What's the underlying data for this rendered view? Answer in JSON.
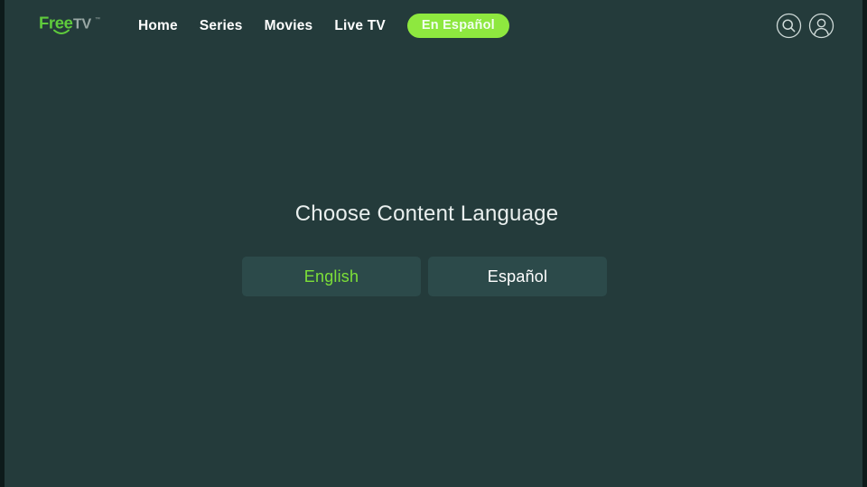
{
  "brand": {
    "name_primary": "Free",
    "name_secondary": "TV",
    "trademark": "™",
    "primary_color": "#5fcb3c",
    "secondary_color": "#9aa8a5"
  },
  "header": {
    "nav": [
      {
        "label": "Home",
        "name": "home"
      },
      {
        "label": "Series",
        "name": "series"
      },
      {
        "label": "Movies",
        "name": "movies"
      },
      {
        "label": "Live TV",
        "name": "live-tv"
      }
    ],
    "pill": {
      "label": "En Español",
      "background": "#8ee83f",
      "text_color": "#f2fff0"
    },
    "actions": [
      {
        "icon": "search-icon"
      },
      {
        "icon": "user-account-icon"
      }
    ]
  },
  "main": {
    "title": "Choose Content Language",
    "languages": [
      {
        "label": "English",
        "selected": true,
        "text_color": "#7de038"
      },
      {
        "label": "Español",
        "selected": false,
        "text_color": "#ffffff"
      }
    ]
  },
  "theme": {
    "page_background": "#243b3b",
    "frame_background": "#0d1a1a",
    "button_background": "#2c4a4a",
    "heading_color": "#e9efee"
  }
}
